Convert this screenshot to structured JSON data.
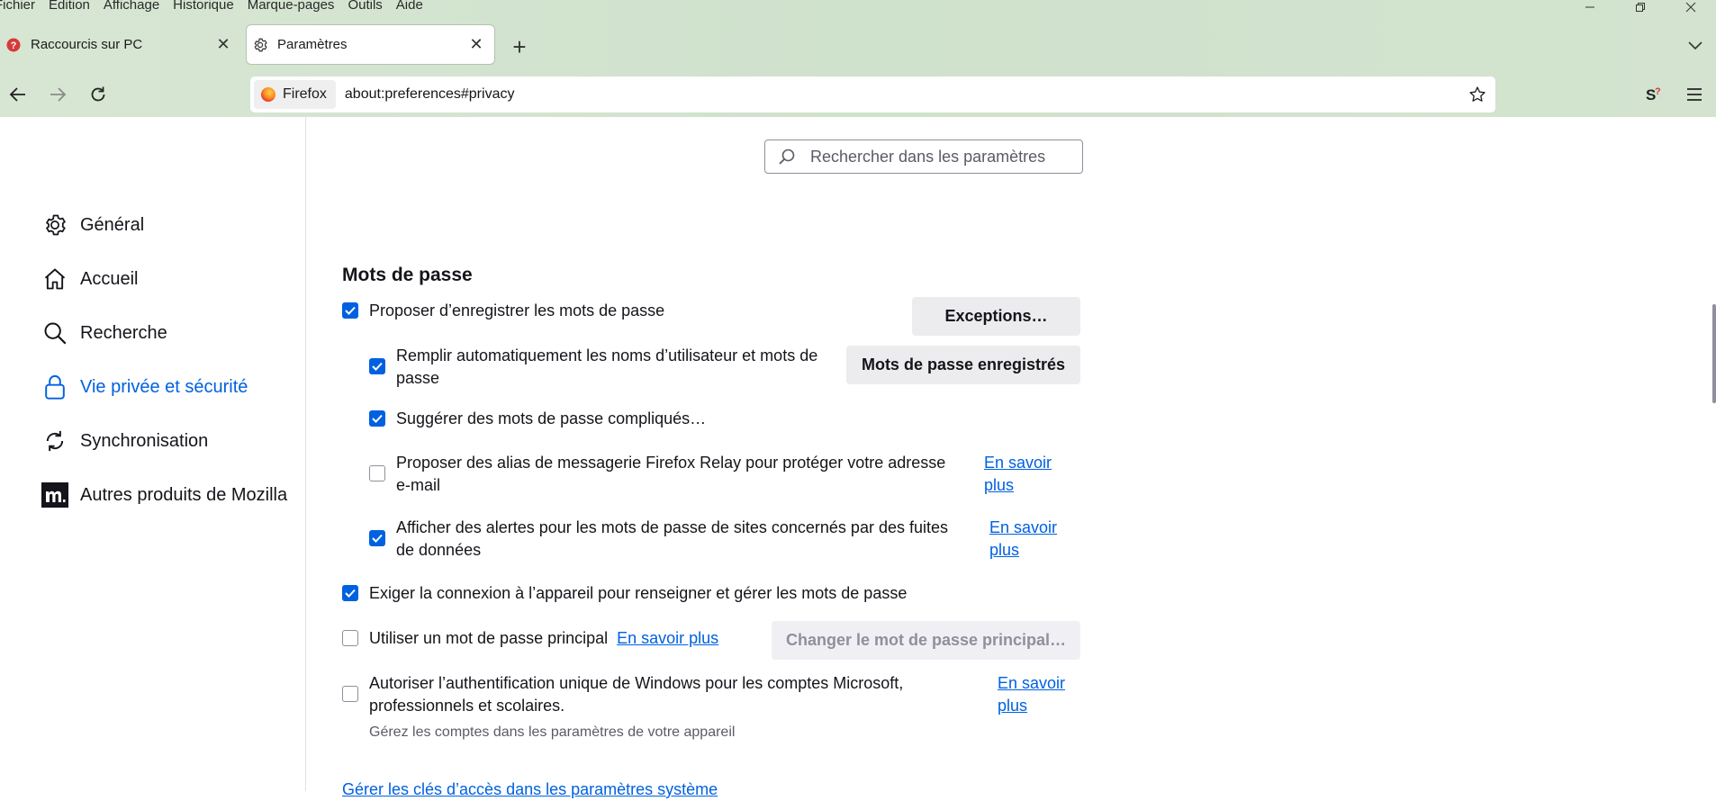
{
  "menubar": [
    "Fichier",
    "Edition",
    "Affichage",
    "Historique",
    "Marque-pages",
    "Outils",
    "Aide"
  ],
  "tabs": [
    {
      "title": "Raccourcis sur PC",
      "icon": "question-favicon-icon"
    },
    {
      "title": "Paramètres",
      "icon": "gear-icon"
    }
  ],
  "urlbar": {
    "identity": "Firefox",
    "url": "about:preferences#privacy"
  },
  "search": {
    "placeholder": "Rechercher dans les paramètres"
  },
  "categories": [
    {
      "label": "Général",
      "icon": "gear-icon"
    },
    {
      "label": "Accueil",
      "icon": "home-icon"
    },
    {
      "label": "Recherche",
      "icon": "search-icon"
    },
    {
      "label": "Vie privée et sécurité",
      "icon": "lock-icon",
      "active": true
    },
    {
      "label": "Synchronisation",
      "icon": "sync-icon"
    },
    {
      "label": "Autres produits de Mozilla",
      "icon": "mozilla-icon"
    }
  ],
  "passwords": {
    "title": "Mots de passe",
    "offer_save": "Proposer d’enregistrer les mots de passe",
    "exceptions": "Exceptions…",
    "autofill_line1": "Remplir automatiquement les noms d’utilisateur et mots de",
    "autofill_line2": "passe",
    "saved_logins": "Mots de passe enregistrés",
    "suggest": "Suggérer des mots de passe compliqués…",
    "relay_line1": "Proposer des alias de messagerie Firefox Relay pour protéger votre adresse",
    "relay_line2": "e-mail",
    "breach_line1": "Afficher des alertes pour les mots de passe de sites concernés par des fuites",
    "breach_line2": "de données",
    "os_auth": "Exiger la connexion à l’appareil pour renseigner et gérer les mots de passe",
    "primary": "Utiliser un mot de passe principal",
    "change_primary": "Changer le mot de passe principal…",
    "sso_line1": "Autoriser l’authentification unique de Windows pour les comptes Microsoft,",
    "sso_line2": "professionnels et scolaires.",
    "sso_note": "Gérez les comptes dans les paramètres de votre appareil",
    "learn_more_line1": "En savoir",
    "learn_more_line2": "plus",
    "learn_more": "En savoir plus",
    "passkeys": "Gérer les clés d’accès dans les paramètres système"
  }
}
